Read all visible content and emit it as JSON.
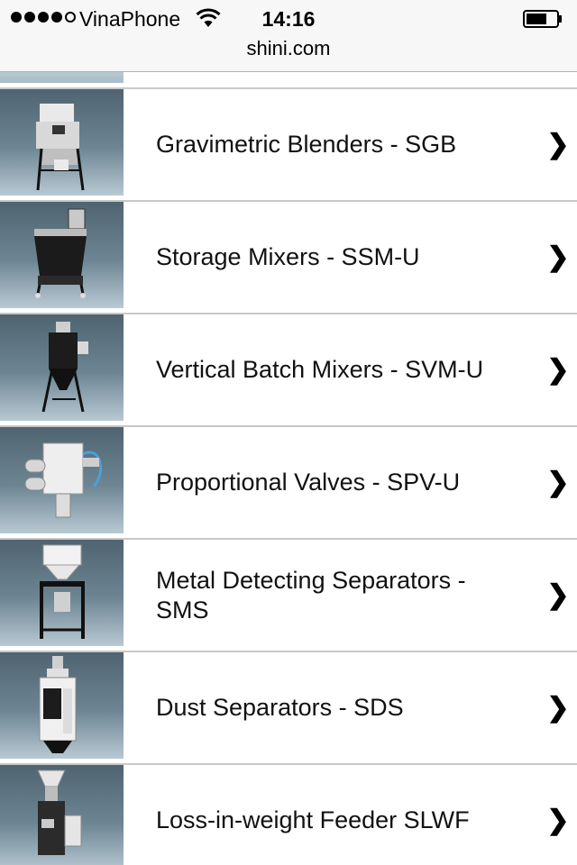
{
  "status_bar": {
    "carrier": "VinaPhone",
    "time": "14:16"
  },
  "browser": {
    "url": "shini.com"
  },
  "products": [
    {
      "label": "Gravimetric Blenders - SGB",
      "chevron": "❯",
      "icon": "gravimetric-blender-image"
    },
    {
      "label": "Storage Mixers - SSM-U",
      "chevron": "❯",
      "icon": "storage-mixer-image"
    },
    {
      "label": "Vertical Batch Mixers - SVM-U",
      "chevron": "❯",
      "icon": "vertical-batch-mixer-image"
    },
    {
      "label": "Proportional Valves - SPV-U",
      "chevron": "❯",
      "icon": "proportional-valve-image"
    },
    {
      "label": "Metal Detecting Separators - SMS",
      "chevron": "❯",
      "icon": "metal-detecting-separator-image"
    },
    {
      "label": "Dust Separators - SDS",
      "chevron": "❯",
      "icon": "dust-separator-image"
    },
    {
      "label": "Loss-in-weight Feeder SLWF",
      "chevron": "❯",
      "icon": "loss-in-weight-feeder-image"
    }
  ]
}
